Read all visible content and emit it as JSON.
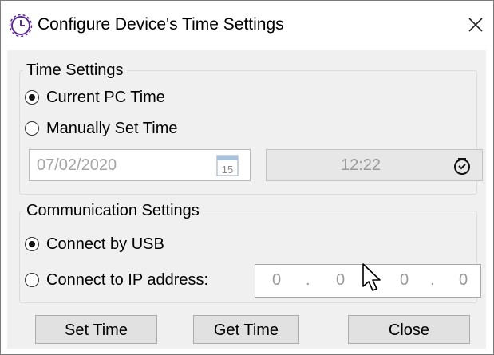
{
  "window": {
    "title": "Configure Device's Time Settings",
    "close_glyph": "✕",
    "icon": "clock-icon"
  },
  "time_settings": {
    "legend": "Time Settings",
    "options": [
      {
        "label": "Current PC Time",
        "checked": true
      },
      {
        "label": "Manually Set Time",
        "checked": false
      }
    ],
    "date_value": "07/02/2020",
    "calendar_day": "15",
    "time_value": "12:22"
  },
  "communication_settings": {
    "legend": "Communication Settings",
    "options": [
      {
        "label": "Connect by USB",
        "checked": true
      },
      {
        "label": "Connect to IP address:",
        "checked": false
      }
    ],
    "ip_octets": [
      "0",
      "0",
      "0",
      "0"
    ],
    "ip_separator": "."
  },
  "buttons": {
    "set_time": "Set Time",
    "get_time": "Get Time",
    "close": "Close"
  },
  "colors": {
    "client_bg": "#f0f0f0",
    "button_bg": "#e1e1e1",
    "disabled_text": "#9a9a9a",
    "accent": "#5b2c8f"
  }
}
